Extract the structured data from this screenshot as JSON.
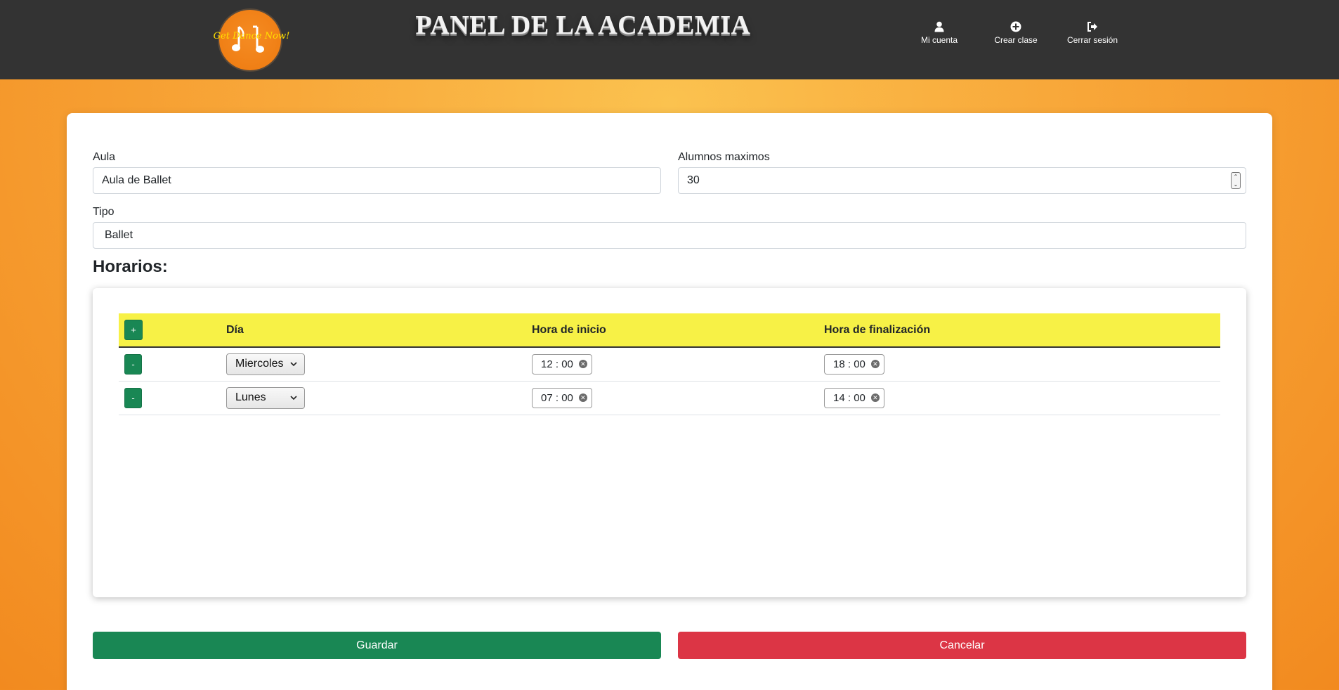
{
  "header": {
    "logo_text": "Get Dance Now!",
    "title": "PANEL DE LA ACADEMIA",
    "nav": [
      {
        "label": "Mi cuenta",
        "icon": "user-icon"
      },
      {
        "label": "Crear clase",
        "icon": "plus-circle-icon"
      },
      {
        "label": "Cerrar sesión",
        "icon": "sign-out-icon"
      }
    ]
  },
  "form": {
    "aula_label": "Aula",
    "aula_value": "Aula de Ballet",
    "alumnos_label": "Alumnos maximos",
    "alumnos_value": "30",
    "tipo_label": "Tipo",
    "tipo_value": "Ballet"
  },
  "horarios": {
    "title": "Horarios:",
    "add_label": "+",
    "remove_label": "-",
    "columns": [
      "Día",
      "Hora de inicio",
      "Hora de finalización"
    ],
    "rows": [
      {
        "dia": "Miercoles",
        "inicio_h": "12",
        "inicio_m": "00",
        "fin_h": "18",
        "fin_m": "00"
      },
      {
        "dia": "Lunes",
        "inicio_h": "07",
        "inicio_m": "00",
        "fin_h": "14",
        "fin_m": "00"
      }
    ]
  },
  "actions": {
    "save_label": "Guardar",
    "cancel_label": "Cancelar"
  },
  "colors": {
    "save": "#198754",
    "cancel": "#dc3545",
    "table_header": "#f7f146",
    "topbar": "#333333"
  }
}
